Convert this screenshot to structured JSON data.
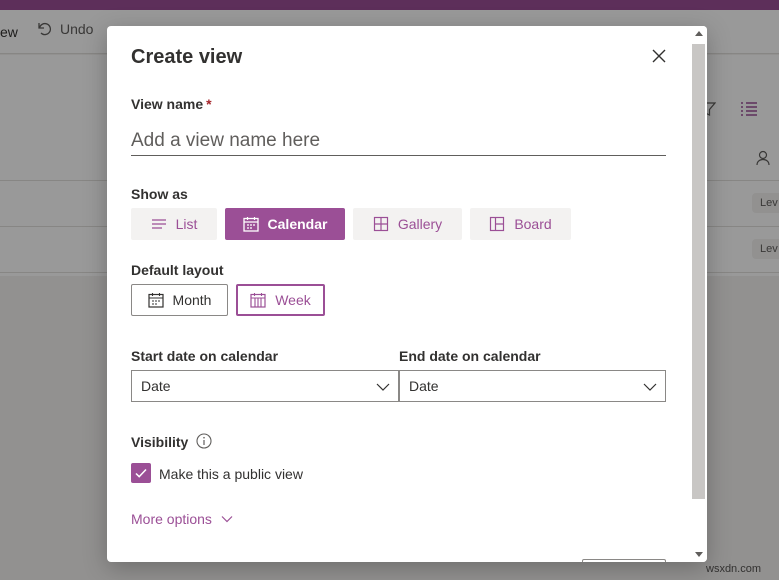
{
  "background": {
    "command_bar": {
      "view_partial": "ew",
      "undo_label": "Undo"
    },
    "rows": [
      {
        "badge": "Lev"
      },
      {
        "badge": "Lev"
      }
    ]
  },
  "dialog": {
    "title": "Create view",
    "view_name": {
      "label": "View name",
      "required_marker": "*",
      "placeholder": "Add a view name here",
      "value": ""
    },
    "show_as": {
      "label": "Show as",
      "options": [
        {
          "label": "List",
          "icon": "list-icon",
          "selected": false
        },
        {
          "label": "Calendar",
          "icon": "calendar-icon",
          "selected": true
        },
        {
          "label": "Gallery",
          "icon": "gallery-icon",
          "selected": false
        },
        {
          "label": "Board",
          "icon": "board-icon",
          "selected": false
        }
      ]
    },
    "default_layout": {
      "label": "Default layout",
      "options": [
        {
          "label": "Month",
          "icon": "calendar-month-icon",
          "selected": false
        },
        {
          "label": "Week",
          "icon": "calendar-week-icon",
          "selected": true
        }
      ]
    },
    "start_date": {
      "label": "Start date on calendar",
      "value": "Date"
    },
    "end_date": {
      "label": "End date on calendar",
      "value": "Date"
    },
    "visibility": {
      "label": "Visibility",
      "checkbox_label": "Make this a public view",
      "checked": true
    },
    "more_options": "More options"
  },
  "watermark": "wsxdn.com",
  "colors": {
    "accent": "#9b4f96",
    "neutral_bg": "#f3f2f1",
    "text": "#323130",
    "required": "#a4262c"
  }
}
